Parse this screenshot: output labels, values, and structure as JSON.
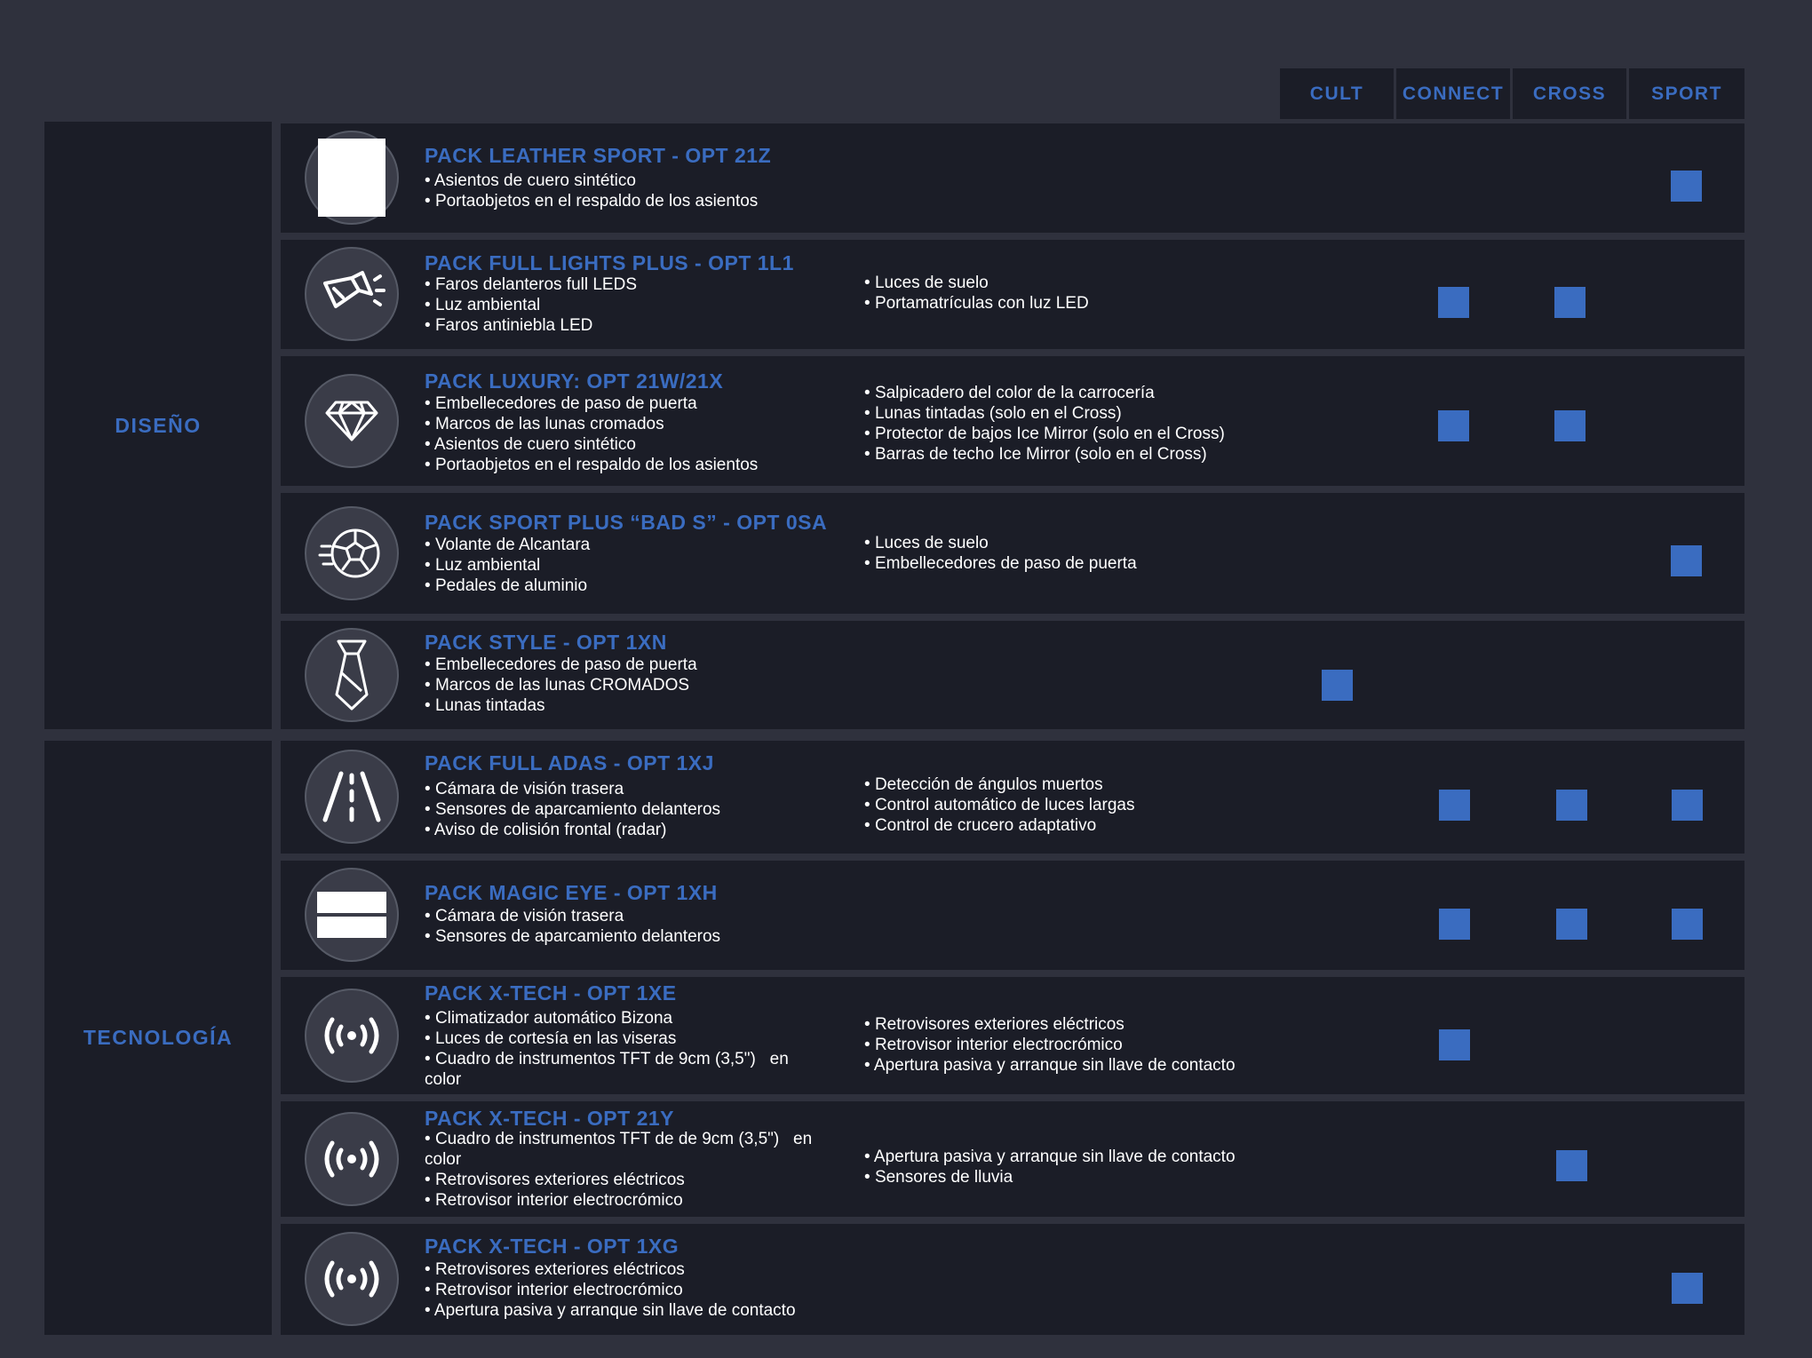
{
  "columns": [
    "CULT",
    "CONNECT",
    "CROSS",
    "SPORT"
  ],
  "categories": {
    "design": "DISEÑO",
    "tech": "TECNOLOGÍA"
  },
  "packs": [
    {
      "title": "PACK LEATHER SPORT - OPT 21Z",
      "icon": "seat-placeholder-icon",
      "col1": [
        "Asientos de cuero sintético",
        "Portaobjetos en el respaldo de los asientos"
      ],
      "col2": [],
      "available": [
        "SPORT"
      ]
    },
    {
      "title": "PACK FULL LIGHTS PLUS - OPT 1L1",
      "icon": "flashlight-icon",
      "col1": [
        "Faros delanteros full LEDS",
        "Luz ambiental",
        "Faros antiniebla LED"
      ],
      "col2": [
        "Luces de suelo",
        "Portamatrículas con luz LED"
      ],
      "available": [
        "CONNECT",
        "CROSS"
      ]
    },
    {
      "title": "PACK LUXURY: OPT 21W/21X",
      "icon": "diamond-icon",
      "col1": [
        "Embellecedores de paso de puerta",
        "Marcos de las lunas cromados",
        "Asientos de cuero sintético",
        "Portaobjetos en el respaldo de los asientos"
      ],
      "col2": [
        "Salpicadero del color de la carrocería",
        "Lunas tintadas (solo en el Cross)",
        "Protector de bajos Ice Mirror (solo en el Cross)",
        "Barras de techo Ice Mirror (solo en el Cross)"
      ],
      "available": [
        "CONNECT",
        "CROSS"
      ]
    },
    {
      "title": "PACK SPORT PLUS “BAD S” - OPT 0SA",
      "icon": "soccer-ball-icon",
      "col1": [
        "Volante de Alcantara",
        "Luz ambiental",
        "Pedales de aluminio"
      ],
      "col2": [
        "Luces de suelo",
        "Embellecedores de paso de puerta"
      ],
      "available": [
        "SPORT"
      ]
    },
    {
      "title": "PACK STYLE - OPT 1XN",
      "icon": "tie-icon",
      "col1": [
        "Embellecedores de paso de puerta",
        "Marcos de las lunas CROMADOS",
        "Lunas tintadas"
      ],
      "col2": [],
      "available": [
        "CULT"
      ]
    },
    {
      "title": "PACK FULL ADAS - OPT 1XJ",
      "icon": "road-icon",
      "col1": [
        "Cámara de visión trasera",
        "Sensores de aparcamiento delanteros",
        "Aviso de colisión frontal (radar)"
      ],
      "col2": [
        "Detección de ángulos muertos",
        "Control automático de luces largas",
        "Control de crucero adaptativo"
      ],
      "available": [
        "CONNECT",
        "CROSS",
        "SPORT"
      ]
    },
    {
      "title": "PACK MAGIC EYE - OPT 1XH",
      "icon": "display-panel-icon",
      "col1": [
        "Cámara de visión trasera",
        "Sensores de aparcamiento delanteros"
      ],
      "col2": [],
      "available": [
        "CONNECT",
        "CROSS",
        "SPORT"
      ]
    },
    {
      "title": "PACK X-TECH - OPT 1XE",
      "icon": "wireless-signal-icon",
      "col1": [
        "Climatizador automático Bizona",
        "Luces de cortesía en las viseras",
        "Cuadro de instrumentos TFT de 9cm (3,5\")   en color"
      ],
      "col2": [
        "Retrovisores exteriores eléctricos",
        "Retrovisor interior electrocrómico",
        "Apertura pasiva y arranque sin llave de contacto"
      ],
      "available": [
        "CONNECT"
      ]
    },
    {
      "title": "PACK X-TECH - OPT 21Y",
      "icon": "wireless-signal-icon",
      "col1": [
        "Cuadro de instrumentos TFT de de 9cm (3,5\")   en color",
        "Retrovisores exteriores eléctricos",
        "Retrovisor interior electrocrómico"
      ],
      "col2": [
        "Apertura pasiva y arranque sin llave de contacto",
        "Sensores de lluvia"
      ],
      "available": [
        "CROSS"
      ]
    },
    {
      "title": "PACK X-TECH - OPT 1XG",
      "icon": "wireless-signal-icon",
      "col1": [
        "Retrovisores exteriores eléctricos",
        "Retrovisor interior electrocrómico",
        "Apertura pasiva y arranque sin llave de contacto"
      ],
      "col2": [],
      "available": [
        "SPORT"
      ]
    }
  ],
  "colors": {
    "page": "#2f313d",
    "panel": "#1b1d27",
    "accent": "#3a6cc0",
    "text": "#ffffff"
  }
}
